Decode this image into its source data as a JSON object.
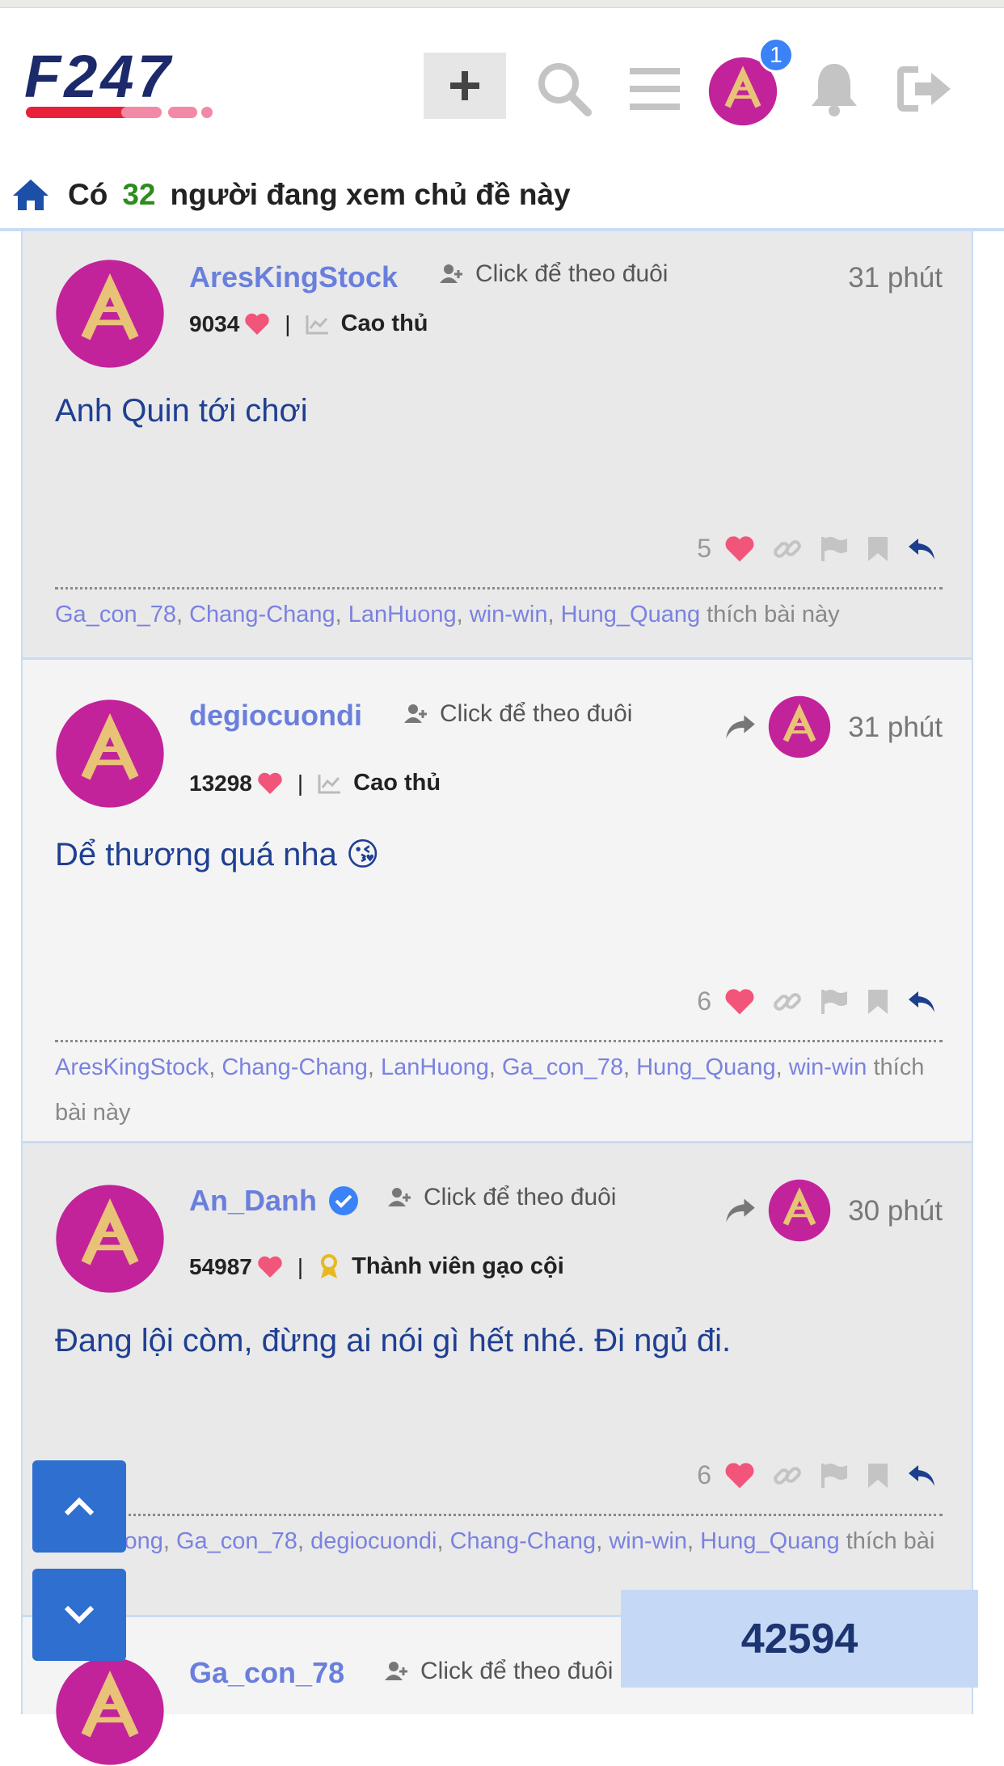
{
  "header": {
    "logo_text": "F247",
    "notification_count": "1"
  },
  "viewers": {
    "prefix": "Có",
    "count": "32",
    "suffix": "người đang xem chủ đề này"
  },
  "follow_label": "Click để theo đuôi",
  "posts": [
    {
      "username": "AresKingStock",
      "likes_total": "9034",
      "rank": "Cao thủ",
      "time": "31 phút",
      "content": "Anh Quin tới chơi",
      "like_count": "5",
      "likers": [
        "Ga_con_78",
        "Chang-Chang",
        "LanHuong",
        "win-win",
        "Hung_Quang"
      ],
      "likers_suffix": "thích bài này"
    },
    {
      "username": "degiocuondi",
      "likes_total": "13298",
      "rank": "Cao thủ",
      "time": "31 phút",
      "content": "Dể thương quá nha 😘",
      "like_count": "6",
      "likers": [
        "AresKingStock",
        "Chang-Chang",
        "LanHuong",
        "Ga_con_78",
        "Hung_Quang",
        "win-win"
      ],
      "likers_suffix": "thích bài này"
    },
    {
      "username": "An_Danh",
      "likes_total": "54987",
      "rank": "Thành viên gạo cội",
      "time": "30 phút",
      "content": "Đang lội còm, đừng ai nói gì hết nhé. Đi ngủ đi.",
      "like_count": "6",
      "likers": [
        "LanHuong",
        "Ga_con_78",
        "degiocuondi",
        "Chang-Chang",
        "win-win",
        "Hung_Quang"
      ],
      "likers_suffix": "thích bài này"
    },
    {
      "username": "Ga_con_78"
    }
  ],
  "counter": "42594",
  "colors": {
    "accent_blue": "#2e6fd0",
    "username": "#6a7fdc",
    "heart": "#f2557a",
    "avatar_magenta": "#c2239a",
    "avatar_gold": "#e8c277",
    "content_text": "#1f3f92"
  },
  "icons": [
    "plus-icon",
    "search-icon",
    "menu-icon",
    "bell-icon",
    "logout-icon",
    "home-icon",
    "heart-icon",
    "link-icon",
    "flag-icon",
    "bookmark-icon",
    "reply-icon",
    "share-icon",
    "user-plus-icon",
    "chart-icon",
    "award-icon",
    "verified-icon",
    "chevron-up-icon",
    "chevron-down-icon"
  ]
}
